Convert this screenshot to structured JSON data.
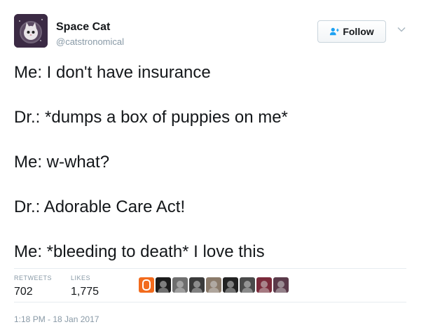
{
  "author": {
    "display_name": "Space Cat",
    "handle": "@catstronomical",
    "avatar_icon": "space-cat-avatar"
  },
  "follow_button": {
    "label": "Follow",
    "icon": "add-user-icon"
  },
  "menu_caret": {
    "icon": "chevron-down-icon"
  },
  "tweet": {
    "lines": [
      "Me: I don't have insurance",
      "Dr.: *dumps a box of puppies on me*",
      "Me: w-what?",
      "Dr.: Adorable Care Act!",
      "Me: *bleeding to death* I love this"
    ]
  },
  "stats": {
    "retweets_label": "RETWEETS",
    "retweets_value": "702",
    "likes_label": "LIKES",
    "likes_value": "1,775"
  },
  "liker_avatars": [
    {
      "color": "#f26b1d"
    },
    {
      "color": "#1b1b1b"
    },
    {
      "color": "#6e6e6e"
    },
    {
      "color": "#3a3a3a"
    },
    {
      "color": "#8a7a6a"
    },
    {
      "color": "#222222"
    },
    {
      "color": "#4a4a4a"
    },
    {
      "color": "#7a2a3a"
    },
    {
      "color": "#5a3a4a"
    }
  ],
  "timestamp": "1:18 PM - 18 Jan 2017",
  "colors": {
    "text": "#14171a",
    "muted": "#8899a6",
    "divider": "#e6ecf0",
    "follow_icon": "#1da1f2"
  }
}
